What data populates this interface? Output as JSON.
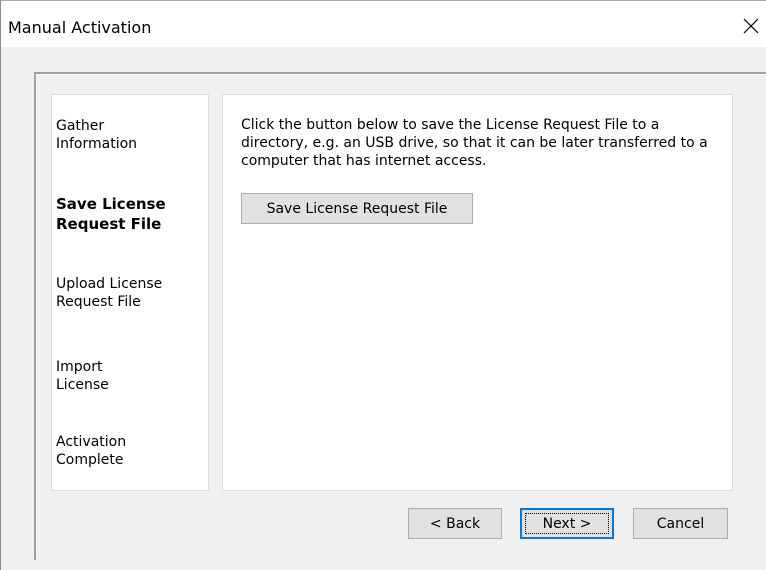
{
  "window": {
    "title": "Manual Activation"
  },
  "steps": [
    {
      "label": "Gather\nInformation",
      "active": false
    },
    {
      "label": "Save License\nRequest File",
      "active": true
    },
    {
      "label": "Upload License\nRequest File",
      "active": false
    },
    {
      "label": "Import\nLicense",
      "active": false
    },
    {
      "label": "Activation\nComplete",
      "active": false
    }
  ],
  "content": {
    "instructions": "Click the button below to save the License Request File to a directory, e.g. an USB drive, so that it can be later transferred to a computer that has internet access.",
    "save_button": "Save License Request File"
  },
  "footer": {
    "back_label": "< Back",
    "next_label": "Next >",
    "cancel_label": "Cancel"
  },
  "icons": {
    "close": "close-icon"
  },
  "colors": {
    "focus_border": "#0078d7",
    "button_face": "#e1e1e1",
    "dialog_background": "#f0f0f0"
  }
}
